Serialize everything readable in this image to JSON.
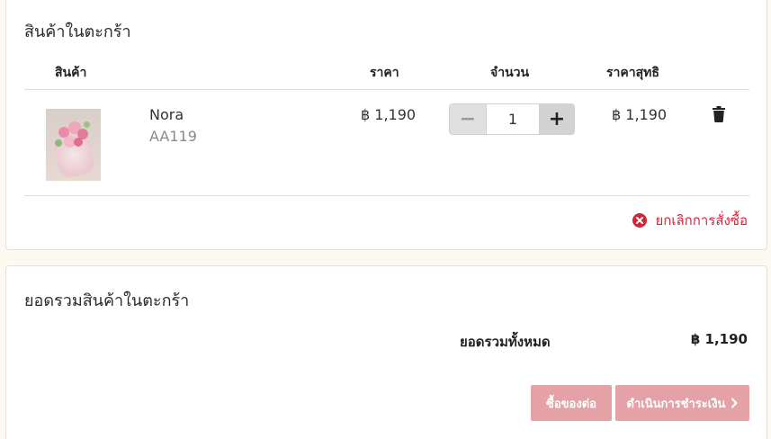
{
  "cart": {
    "title": "สินค้าในตะกร้า",
    "headers": {
      "product": "สินค้า",
      "price": "ราคา",
      "quantity": "จำนวน",
      "net_price": "ราคาสุทธิ"
    },
    "items": [
      {
        "name": "Nora",
        "sku": "AA119",
        "price": "฿ 1,190",
        "quantity": "1",
        "net_price": "฿ 1,190"
      }
    ],
    "cancel_label": "ยกเลิกการสั่งซื้อ"
  },
  "summary": {
    "title": "ยอดรวมสินค้าในตะกร้า",
    "total_label": "ยอดรวมทั้งหมด",
    "total_value": "฿ 1,190",
    "continue_label": "ซื้อของต่อ",
    "checkout_label": "ดำเนินการชำระเงิน"
  },
  "colors": {
    "accent_button": "#e5a2a6",
    "danger": "#d1263a",
    "page_bg": "#fcf9f1"
  },
  "icons": {
    "delete": "trash-icon",
    "cancel": "close-circle-icon",
    "checkout": "chevron-right-icon"
  }
}
